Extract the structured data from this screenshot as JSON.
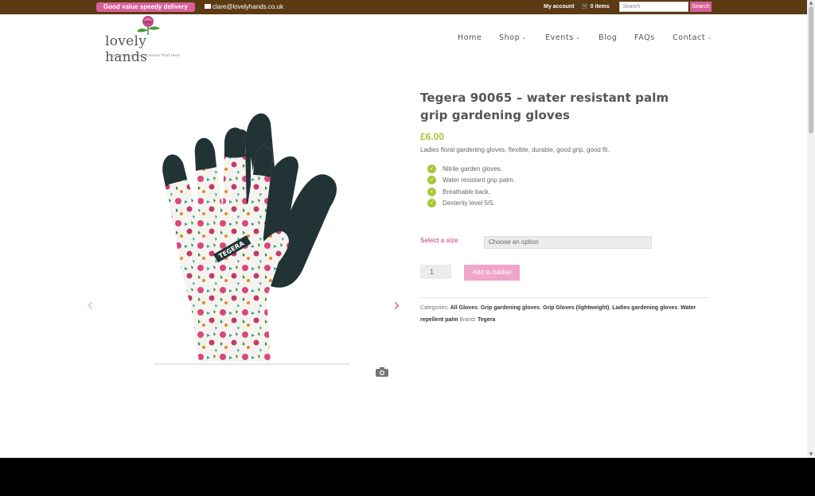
{
  "topbar": {
    "promo": "Good value speedy delivery",
    "email": "clare@lovelyhands.co.uk",
    "account": "My account",
    "cart": "0 items",
    "search_placeholder": "Search",
    "search_button": "Search"
  },
  "logo": {
    "name": "lovely hands",
    "tagline": "gloves that hug, creams that love"
  },
  "nav": [
    {
      "label": "Home"
    },
    {
      "label": "Shop"
    },
    {
      "label": "Events"
    },
    {
      "label": "Blog"
    },
    {
      "label": "FAQs"
    },
    {
      "label": "Contact"
    }
  ],
  "product": {
    "title": "Tegera 90065 – water resistant palm grip gardening gloves",
    "price": "£6.00",
    "short_description": "Ladies floral gardening gloves, flexible, durable, good grip, good fit.",
    "features": [
      "Nitrile garden gloves.",
      "Water resistant grip palm.",
      "Breathable back.",
      "Dexterity level 5/5."
    ],
    "size_label": "Select a size",
    "size_option": "Choose an option",
    "quantity": "1",
    "add_button": "Add to basket",
    "categories_label": "Categories:",
    "categories": [
      "All Gloves",
      "Grip gardening gloves",
      "Grip Gloves (lightweight)",
      "Ladies gardening gloves",
      "Water repellent palm"
    ],
    "brand_label": "Brand:",
    "brand": "Tegera",
    "glove_brand_text": "TEGERA"
  },
  "colors": {
    "topbar": "#5b3a14",
    "accent_pink": "#d8609a",
    "price_green": "#a3c93a"
  }
}
